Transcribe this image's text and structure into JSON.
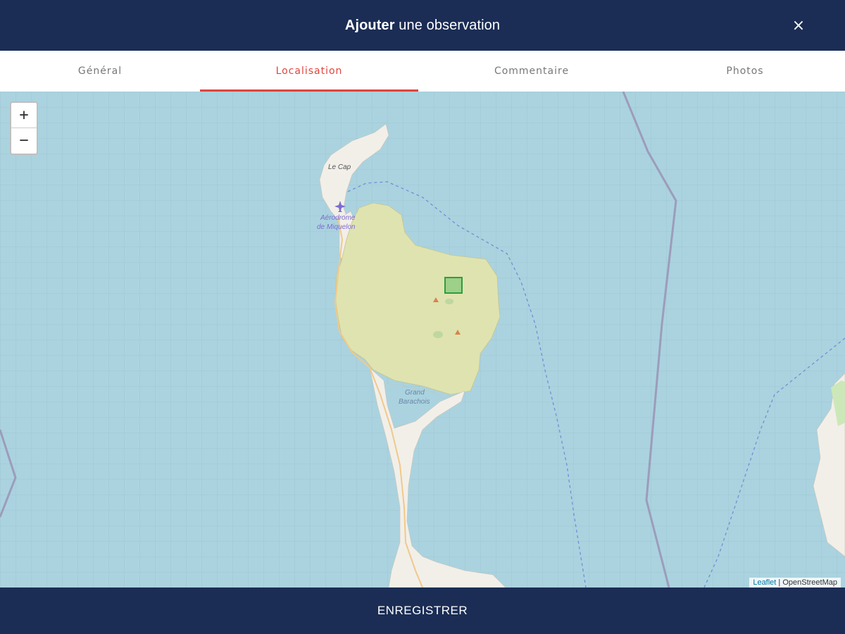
{
  "header": {
    "title_bold": "Ajouter",
    "title_rest": " une observation",
    "close_label": "×"
  },
  "tabs": [
    {
      "label": "Général",
      "active": false
    },
    {
      "label": "Localisation",
      "active": true
    },
    {
      "label": "Commentaire",
      "active": false
    },
    {
      "label": "Photos",
      "active": false
    }
  ],
  "map": {
    "zoom_in": "+",
    "zoom_out": "−",
    "labels": {
      "le_cap": "Le Cap",
      "aerodrome_line1": "Aérodrome",
      "aerodrome_line2": "de Miquelon",
      "grand_barachois_line1": "Grand",
      "grand_barachois_line2": "Barachois"
    },
    "attribution": {
      "leaflet": "Leaflet",
      "separator": " | ",
      "osm": "OpenStreetMap"
    },
    "colors": {
      "water": "#aad3df",
      "land": "#f2efe9",
      "selected_area": "#dfe3b0",
      "marker": "#2e9e3e"
    }
  },
  "footer": {
    "save_label": "ENREGISTRER"
  }
}
